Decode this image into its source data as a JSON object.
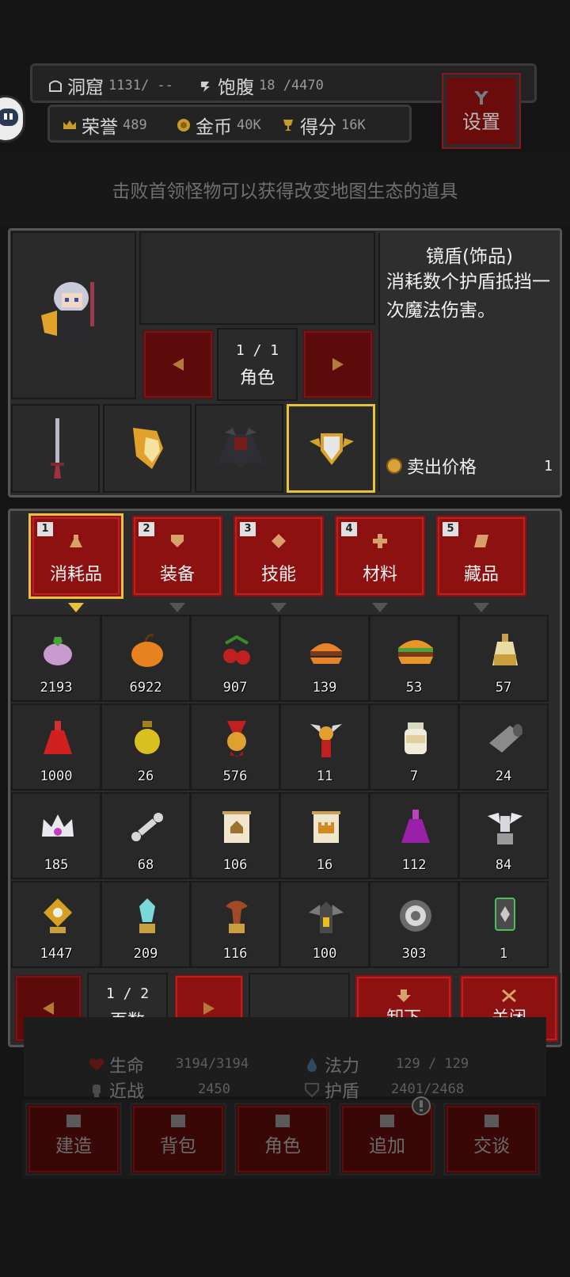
{
  "header": {
    "cave_label": "洞窟",
    "cave_value": "1131/ --",
    "hunger_label": "饱腹",
    "hunger_value": "18 /4470",
    "honor_label": "荣誉",
    "honor_value": "489",
    "gold_label": "金币",
    "gold_value": "40K",
    "score_label": "得分",
    "score_value": "16K",
    "settings_label": "设置"
  },
  "hint_banner": "击败首领怪物可以获得改变地图生态的道具",
  "character_panel": {
    "page": "1 / 1",
    "page_label": "角色"
  },
  "item_detail": {
    "title": "镜盾(饰品)",
    "description": "消耗数个护盾抵挡一次魔法伤害。",
    "sell_label": "卖出价格",
    "sell_price": "1"
  },
  "tabs": [
    {
      "key": "1",
      "label": "消耗品",
      "selected": true
    },
    {
      "key": "2",
      "label": "装备",
      "selected": false
    },
    {
      "key": "3",
      "label": "技能",
      "selected": false
    },
    {
      "key": "4",
      "label": "材料",
      "selected": false
    },
    {
      "key": "5",
      "label": "藏品",
      "selected": false
    }
  ],
  "items": [
    {
      "icon": "turnip-icon",
      "count": "2193"
    },
    {
      "icon": "pumpkin-icon",
      "count": "6922"
    },
    {
      "icon": "cherries-icon",
      "count": "907"
    },
    {
      "icon": "burger-icon",
      "count": "139"
    },
    {
      "icon": "big-burger-icon",
      "count": "53"
    },
    {
      "icon": "oil-bottle-icon",
      "count": "57"
    },
    {
      "icon": "red-potion-icon",
      "count": "1000"
    },
    {
      "icon": "yellow-potion-icon",
      "count": "26"
    },
    {
      "icon": "gold-medal-icon",
      "count": "576"
    },
    {
      "icon": "winged-medal-icon",
      "count": "11"
    },
    {
      "icon": "jar-icon",
      "count": "7"
    },
    {
      "icon": "scroll-roll-icon",
      "count": "24"
    },
    {
      "icon": "crown-icon",
      "count": "185"
    },
    {
      "icon": "bone-icon",
      "count": "68"
    },
    {
      "icon": "house-scroll-icon",
      "count": "106"
    },
    {
      "icon": "castle-scroll-icon",
      "count": "16"
    },
    {
      "icon": "purple-potion-icon",
      "count": "112"
    },
    {
      "icon": "angel-statue-icon",
      "count": "84"
    },
    {
      "icon": "diamond-totem-icon",
      "count": "1447"
    },
    {
      "icon": "crystal-totem-icon",
      "count": "209"
    },
    {
      "icon": "tree-totem-icon",
      "count": "116"
    },
    {
      "icon": "bat-shrine-icon",
      "count": "100"
    },
    {
      "icon": "target-icon",
      "count": "303"
    },
    {
      "icon": "card-icon",
      "count": "1"
    }
  ],
  "inventory_pager": {
    "page": "1 / 2",
    "page_label": "页数",
    "unequip_label": "卸下",
    "close_label": "关闭"
  },
  "player_stats": {
    "hp_label": "生命",
    "hp_value": "3194/3194",
    "mp_label": "法力",
    "mp_value": "129 / 129",
    "melee_label": "近战",
    "melee_value": "2450",
    "shield_label": "护盾",
    "shield_value": "2401/2468"
  },
  "bottom_nav": [
    "建造",
    "背包",
    "角色",
    "追加",
    "交谈"
  ],
  "colors": {
    "accent_red": "#8e1111",
    "selected_gold": "#e8c23a",
    "panel_bg": "#2b2b2b"
  }
}
